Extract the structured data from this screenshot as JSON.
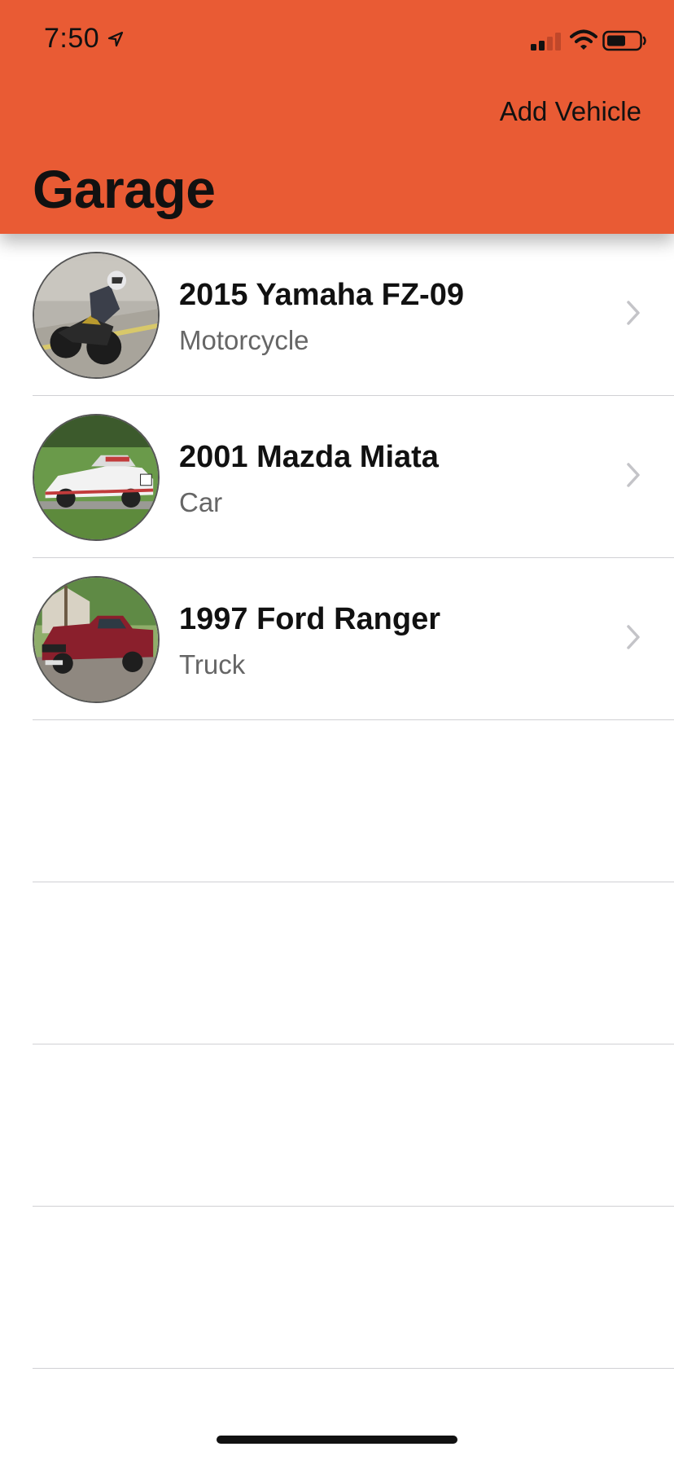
{
  "status_bar": {
    "time": "7:50",
    "icons": [
      "location-arrow-icon",
      "cellular-signal-icon",
      "wifi-icon",
      "battery-icon"
    ]
  },
  "nav": {
    "add_label": "Add Vehicle",
    "title": "Garage"
  },
  "colors": {
    "header": "#E95B34",
    "separator": "#d0d0d4",
    "subtitle": "#666666"
  },
  "vehicles": [
    {
      "name": "2015 Yamaha FZ-09",
      "type": "Motorcycle",
      "photo": "motorcycle-photo"
    },
    {
      "name": "2001 Mazda Miata",
      "type": "Car",
      "photo": "car-photo"
    },
    {
      "name": "1997 Ford Ranger",
      "type": "Truck",
      "photo": "truck-photo"
    }
  ]
}
